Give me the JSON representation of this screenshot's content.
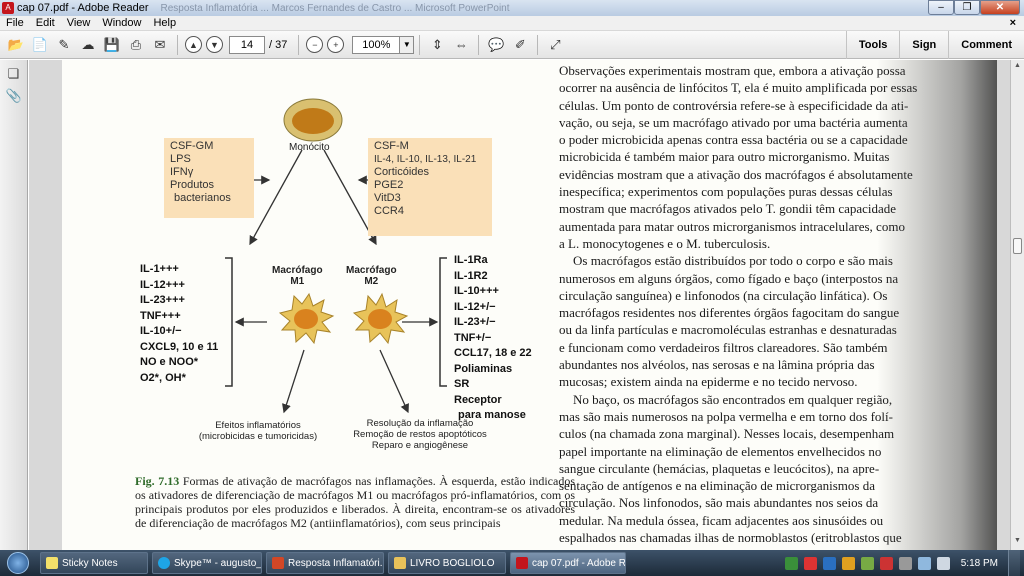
{
  "window": {
    "title": "cap 07.pdf - Adobe Reader",
    "background_title": "Resposta Inflamatória ... Marcos Fernandes de Castro ... Microsoft PowerPoint"
  },
  "menu": [
    "File",
    "Edit",
    "View",
    "Window",
    "Help"
  ],
  "toolbar": {
    "page_current": "14",
    "page_total": "/ 37",
    "zoom": "100%",
    "tools": "Tools",
    "sign": "Sign",
    "comment": "Comment"
  },
  "figure": {
    "monocyte_label": "Monócito",
    "left_box": [
      "CSF-GM",
      "LPS",
      "IFNγ",
      "Produtos",
      "bacterianos"
    ],
    "right_box": [
      "CSF-M",
      "IL-4, IL-10, IL-13, IL-21",
      "Corticóides",
      "PGE2",
      "VitD3",
      "CCR4"
    ],
    "m1_label": [
      "Macrófago",
      "M1"
    ],
    "m2_label": [
      "Macrófago",
      "M2"
    ],
    "m1_products": [
      "IL-1+++",
      "IL-12+++",
      "IL-23+++",
      "TNF+++",
      "IL-10+/−",
      "CXCL9, 10 e 11",
      "NO e NOO*",
      "O2*, OH*"
    ],
    "m2_products": [
      "IL-1Ra",
      "IL-1R2",
      "IL-10+++",
      "IL-12+/−",
      "IL-23+/−",
      "TNF+/−",
      "CCL17, 18 e 22",
      "Poliaminas",
      "SR",
      "Receptor",
      "para manose"
    ],
    "m1_effect": [
      "Efeitos inflamatórios",
      "(microbicidas e tumoricidas)"
    ],
    "m2_effect": [
      "Resolução da inflamação",
      "Remoção de restos apoptóticos",
      "Reparo e angiogênese"
    ],
    "caption_label": "Fig. 7.13",
    "caption_text": "Formas de ativação de macrófagos nas inflamações. À esquerda, estão indicados os ativadores de diferenciação de macrófagos M1 ou macrófagos pró-inflamatórios, com os principais produtos por eles produzidos e liberados. À direita, encontram-se os ativadores de diferenciação de macrófagos M2 (antiinflamatórios), com seus principais"
  },
  "body_lines": [
    "Observações experimentais mostram que, embora a ativação possa",
    "ocorrer na ausência de linfócitos T, ela é muito amplificada por essas",
    "células. Um ponto de controvérsia refere-se à especificidade da ati-",
    "vação, ou seja, se um macrófago ativado por uma bactéria aumenta",
    "o poder microbicida apenas contra essa bactéria ou se a capacidade",
    "microbicida é também maior para outro microrganismo. Muitas",
    "evidências mostram que a ativação dos macrófagos é absolutamente",
    "inespecífica; experimentos com populações puras dessas células",
    "mostram que macrófagos ativados pelo T. gondii têm capacidade",
    "aumentada para matar outros microrganismos intracelulares, como",
    "a L. monocytogenes e o M. tuberculosis.",
    "Os macrófagos estão distribuídos por todo o corpo e são mais",
    "numerosos em alguns órgãos, como fígado e baço (interpostos na",
    "circulação sanguínea) e linfonodos (na circulação linfática). Os",
    "macrófagos residentes nos diferentes órgãos fagocitam do sangue",
    "ou da linfa partículas e macromoléculas estranhas e desnaturadas",
    "e funcionam como verdadeiros filtros clareadores. São também",
    "abundantes nos alvéolos, nas serosas e na lâmina própria das",
    "mucosas; existem ainda na epiderme e no tecido nervoso.",
    "No baço, os macrófagos são encontrados em qualquer região,",
    "mas são mais numerosos na polpa vermelha e em torno dos folí-",
    "culos (na chamada zona marginal). Nesses locais, desempenham",
    "papel importante na eliminação de elementos envelhecidos no",
    "sangue circulante (hemácias, plaquetas e leucócitos), na apre-",
    "sentação de antígenos e na eliminação de microrganismos da",
    "circulação. Nos linfonodos, são mais abundantes nos seios da",
    "medular. Na medula óssea, ficam adjacentes aos sinusóides ou",
    "espalhados nas chamadas ilhas de normoblastos (eritroblastos que"
  ],
  "taskbar": {
    "tasks": [
      "Sticky Notes",
      "Skype™ - augusto_sc...",
      "Resposta Inflamatóri...",
      "LIVRO BOGLIOLO",
      "cap 07.pdf - Adobe R..."
    ],
    "clock": "5:18 PM"
  },
  "colors": {
    "box_fill": "#fae0b8",
    "cell_orange": "#e8951c",
    "caption_green": "#2f6b2a"
  }
}
